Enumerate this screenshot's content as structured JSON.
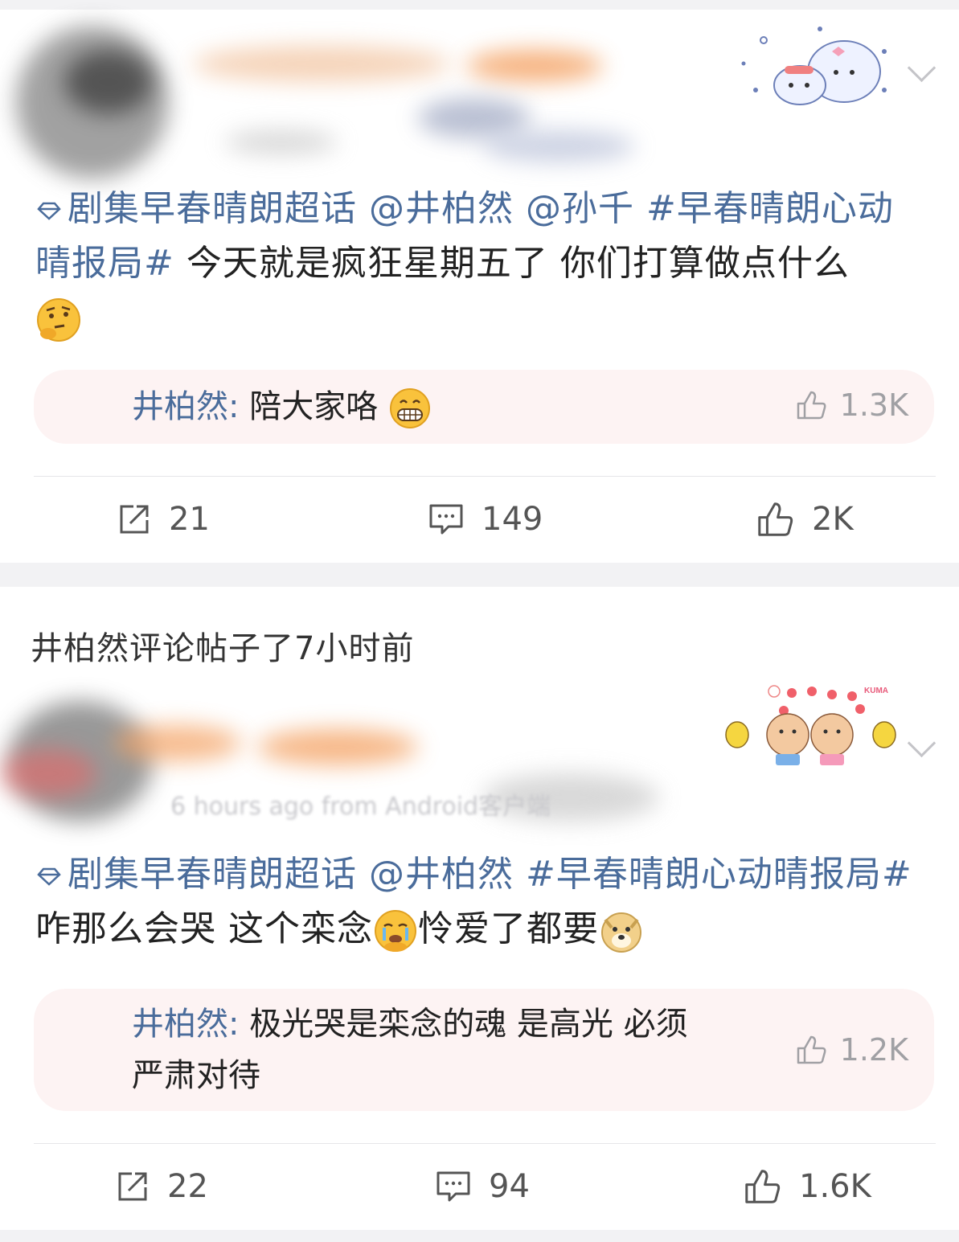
{
  "posts": [
    {
      "topic": "剧集早春晴朗超话",
      "mentions": [
        "@井柏然",
        "@孙千"
      ],
      "hashtag": "#早春晴朗心动晴报局#",
      "text": "今天就是疯狂星期五了 你们打算做点什么",
      "reply": {
        "name": "井柏然:",
        "text": "陪大家咯",
        "likes": "1.3K"
      },
      "actions": {
        "repost": "21",
        "comment": "149",
        "like": "2K"
      }
    },
    {
      "meta": "6 hours ago  from Android客户端",
      "topic": "剧集早春晴朗超话",
      "mentions": [
        "@井柏然"
      ],
      "hashtag": "#早春晴朗心动晴报局#",
      "text_a": "咋那么会哭 这个栾念",
      "text_b": "怜爱了都要",
      "reply": {
        "name": "井柏然:",
        "line1": "极光哭是栾念的魂 是高光 必须",
        "line2": "严肃对待",
        "likes": "1.2K"
      },
      "actions": {
        "repost": "22",
        "comment": "94",
        "like": "1.6K"
      }
    }
  ],
  "section_header": "井柏然评论帖子了7小时前",
  "sticker2_label": "KUMA",
  "colors": {
    "link": "#4a6c9b",
    "reply_bg": "#fdf3f3",
    "text": "#222222",
    "muted": "#a0a0a4"
  },
  "icons": [
    "diamond-icon",
    "thinking-emoji",
    "grin-emoji",
    "cry-emoji",
    "doge-emoji",
    "repost-icon",
    "comment-icon",
    "like-icon",
    "chevron-down-icon"
  ]
}
